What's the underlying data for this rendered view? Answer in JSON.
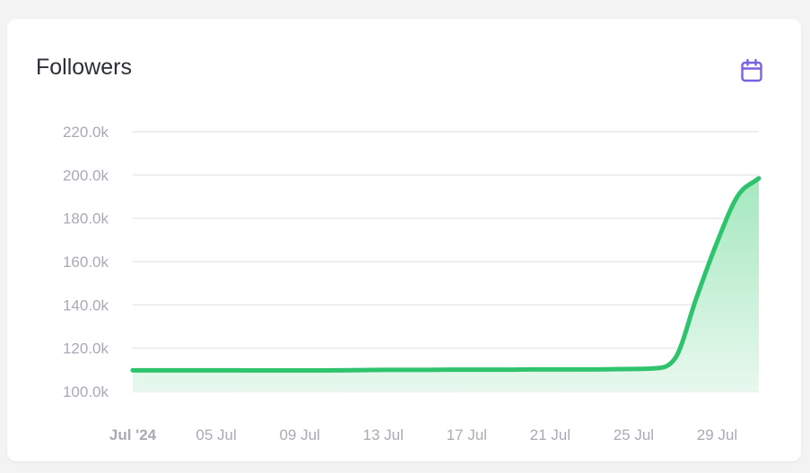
{
  "card": {
    "title": "Followers"
  },
  "icons": {
    "calendar": "calendar-icon"
  },
  "colors": {
    "line": "#2ec36c",
    "area_top": "#a4e8bf",
    "area_bottom": "#e8f8ee",
    "accent": "#7b61e0",
    "grid": "#e9e9ee",
    "tick": "#a9aab4"
  },
  "chart_data": {
    "type": "area",
    "title": "Followers",
    "xlabel": "",
    "ylabel": "",
    "ylim": [
      100000,
      220000
    ],
    "y_ticks": [
      100000,
      120000,
      140000,
      160000,
      180000,
      200000,
      220000
    ],
    "y_tick_labels": [
      "100.0k",
      "120.0k",
      "140.0k",
      "160.0k",
      "180.0k",
      "200.0k",
      "220.0k"
    ],
    "x_range": [
      "2024-07-01",
      "2024-07-31"
    ],
    "x_ticks": [
      "2024-07-01",
      "2024-07-05",
      "2024-07-09",
      "2024-07-13",
      "2024-07-17",
      "2024-07-21",
      "2024-07-25",
      "2024-07-29"
    ],
    "x_tick_labels": [
      "Jul '24",
      "05 Jul",
      "09 Jul",
      "13 Jul",
      "17 Jul",
      "21 Jul",
      "25 Jul",
      "29 Jul"
    ],
    "grid": true,
    "series": [
      {
        "x": [
          "2024-07-01",
          "2024-07-02",
          "2024-07-03",
          "2024-07-04",
          "2024-07-05",
          "2024-07-06",
          "2024-07-07",
          "2024-07-08",
          "2024-07-09",
          "2024-07-10",
          "2024-07-11",
          "2024-07-12",
          "2024-07-13",
          "2024-07-14",
          "2024-07-15",
          "2024-07-16",
          "2024-07-17",
          "2024-07-18",
          "2024-07-19",
          "2024-07-20",
          "2024-07-21",
          "2024-07-22",
          "2024-07-23",
          "2024-07-24",
          "2024-07-25",
          "2024-07-26",
          "2024-07-27",
          "2024-07-28",
          "2024-07-29",
          "2024-07-30",
          "2024-07-31"
        ],
        "values": [
          109800,
          109800,
          109800,
          109800,
          109800,
          109800,
          109700,
          109700,
          109700,
          109700,
          109800,
          109900,
          110000,
          110000,
          110000,
          110100,
          110100,
          110100,
          110100,
          110200,
          110200,
          110200,
          110200,
          110300,
          110400,
          110700,
          115500,
          143000,
          169000,
          190500,
          198500
        ]
      }
    ]
  }
}
